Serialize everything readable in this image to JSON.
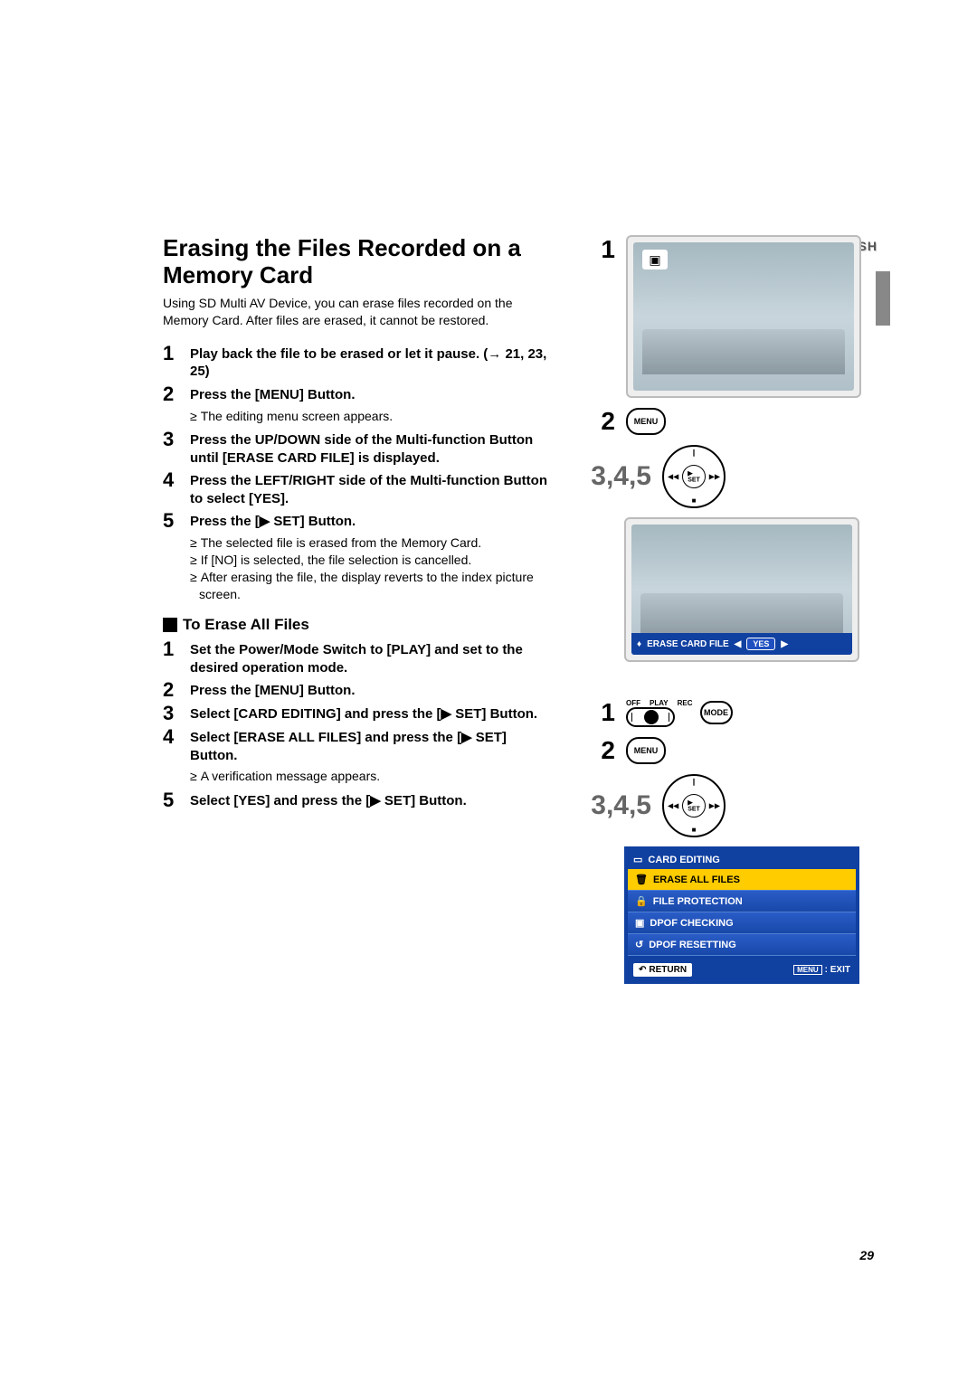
{
  "language_tag": "ENGLISH",
  "page_number": "29",
  "title": "Erasing the Files Recorded on a Memory Card",
  "intro": "Using SD Multi AV Device, you can erase files recorded on the Memory Card. After files are erased, it cannot be restored.",
  "steps": {
    "1": "Play back the file to be erased or let it pause. (→ 21, 23, 25)",
    "2": "Press the [MENU] Button.",
    "2_sub": [
      "The editing menu screen appears."
    ],
    "3": "Press the UP/DOWN side of the Multi-function Button until [ERASE CARD FILE] is displayed.",
    "4": "Press the LEFT/RIGHT side of the Multi-function Button to select [YES].",
    "5": "Press the [▶ SET] Button.",
    "5_sub": [
      "The selected file is erased from the Memory Card.",
      "If [NO] is selected, the file selection is cancelled.",
      "After erasing the file, the display reverts to the index picture screen."
    ]
  },
  "subhead": "To Erase All Files",
  "erase_all_steps": {
    "1": "Set the Power/Mode Switch to [PLAY] and set to the desired operation mode.",
    "2": "Press the [MENU] Button.",
    "3": "Select [CARD EDITING] and press the [▶ SET] Button.",
    "4": "Select [ERASE ALL FILES] and press the [▶ SET] Button.",
    "4_sub": [
      "A verification message appears."
    ],
    "5": "Select [YES] and press the [▶ SET] Button."
  },
  "callouts_a": {
    "n1": "1",
    "n2": "2",
    "n345": "3,4,5"
  },
  "callouts_b": {
    "n1": "1",
    "n2": "2",
    "n345": "3,4,5"
  },
  "buttons": {
    "menu": "MENU",
    "mode": "MODE",
    "set": "SET"
  },
  "mode_switch": {
    "off": "OFF",
    "play": "PLAY",
    "rec": "REC"
  },
  "dpad_set": "▶\nSET",
  "erase_strip": {
    "label": "ERASE CARD FILE",
    "option": "YES"
  },
  "menu_box": {
    "header": "CARD EDITING",
    "items": [
      "ERASE ALL FILES",
      "FILE PROTECTION",
      "DPOF CHECKING",
      "DPOF RESETTING"
    ],
    "return": "RETURN",
    "menu_label": "MENU",
    "exit": ": EXIT"
  }
}
